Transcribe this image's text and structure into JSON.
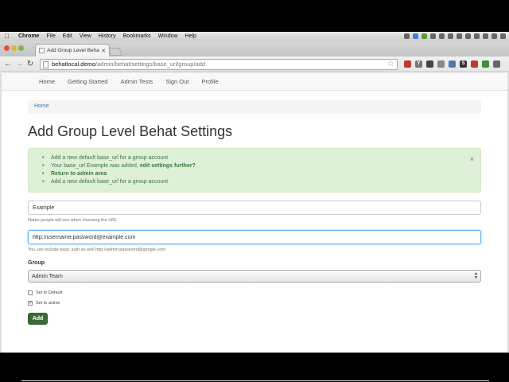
{
  "menubar": {
    "app": "Chrome",
    "items": [
      "File",
      "Edit",
      "View",
      "History",
      "Bookmarks",
      "Window",
      "Help"
    ]
  },
  "browser": {
    "tab_title": "Add Group Level Behat Set",
    "url_host": "behatlocal.demo",
    "url_path": "/admin/behat/settings/base_url/group/add",
    "extensions": [
      "Y",
      "S"
    ]
  },
  "navbar": {
    "links": [
      "Home",
      "Getting Started",
      "Admin Tests",
      "Sign Out",
      "Profile"
    ]
  },
  "page": {
    "breadcrumb": "Home",
    "title": "Add Group Level Behat Settings",
    "alert": {
      "line1": "Add a new default base_url for a group account",
      "line2_prefix": "Your base_url Example was added,",
      "line2_link": "edit settings further?",
      "line3": "Return to admin area",
      "line4": "Add a new default base_url for a group account",
      "close": "×"
    },
    "form": {
      "name_value": "Example",
      "name_help": "Name people will see when choosing the URL",
      "url_value": "http://username:password@example.com",
      "url_help": "You can include basic auth as well http://admin:password@google.com",
      "group_label": "Group",
      "group_selected": "Admin Team",
      "set_default_label": "Set to Default",
      "set_default_checked": false,
      "set_active_label": "Set to active",
      "set_active_checked": true,
      "submit_label": "Add"
    }
  },
  "colors": {
    "alert_bg": "#dff0d8",
    "alert_text": "#3c763d",
    "button_bg": "#3a6b35",
    "link": "#337ab7"
  }
}
